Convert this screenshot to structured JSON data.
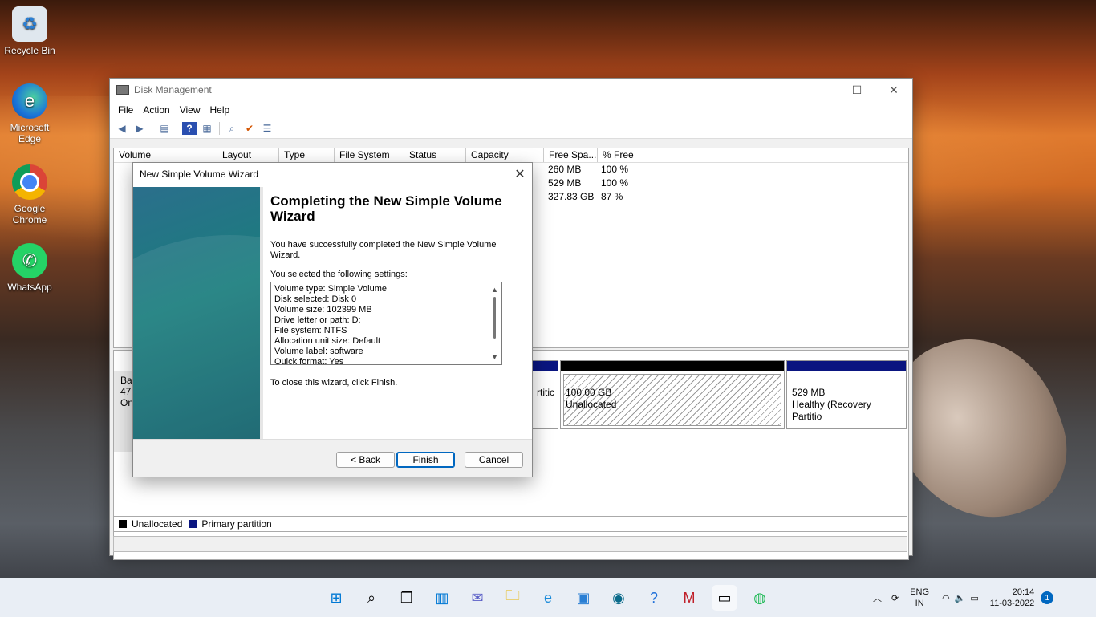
{
  "desktop": {
    "icons": [
      {
        "label": "Recycle Bin",
        "icon": "recycle-bin-icon"
      },
      {
        "label": "Microsoft Edge",
        "icon": "edge-icon"
      },
      {
        "label": "Google Chrome",
        "icon": "chrome-icon"
      },
      {
        "label": "WhatsApp",
        "icon": "whatsapp-icon"
      }
    ]
  },
  "window": {
    "title": "Disk Management",
    "menu": [
      "File",
      "Action",
      "View",
      "Help"
    ],
    "columns": [
      "Volume",
      "Layout",
      "Type",
      "File System",
      "Status",
      "Capacity",
      "Free Spa...",
      "% Free"
    ],
    "rows": [
      {
        "free": "260 MB",
        "pct": "100 %"
      },
      {
        "free": "529 MB",
        "pct": "100 %"
      },
      {
        "free": "327.83 GB",
        "pct": "87 %"
      }
    ],
    "disk_label_fragments": [
      "Bas",
      "47(",
      "On"
    ],
    "partial_partition_text": "rtitic",
    "unallocated": {
      "size": "100.00 GB",
      "label": "Unallocated"
    },
    "recovery": {
      "size": "529 MB",
      "label": "Healthy (Recovery Partitio"
    },
    "legend": [
      {
        "label": "Unallocated",
        "color": "#000000"
      },
      {
        "label": "Primary partition",
        "color": "#0a1580"
      }
    ]
  },
  "dialog": {
    "title": "New Simple Volume Wizard",
    "heading": "Completing the New Simple Volume Wizard",
    "intro": "You have successfully completed the New Simple Volume Wizard.",
    "settings_label": "You selected the following settings:",
    "settings": [
      "Volume type: Simple Volume",
      "Disk selected: Disk 0",
      "Volume size: 102399 MB",
      "Drive letter or path: D:",
      "File system: NTFS",
      "Allocation unit size: Default",
      "Volume label: software",
      "Quick format: Yes"
    ],
    "close_hint": "To close this wizard, click Finish.",
    "buttons": {
      "back": "< Back",
      "finish": "Finish",
      "cancel": "Cancel"
    }
  },
  "taskbar": {
    "lang1": "ENG",
    "lang2": "IN",
    "time": "20:14",
    "date": "11-03-2022",
    "notif_count": "1"
  }
}
